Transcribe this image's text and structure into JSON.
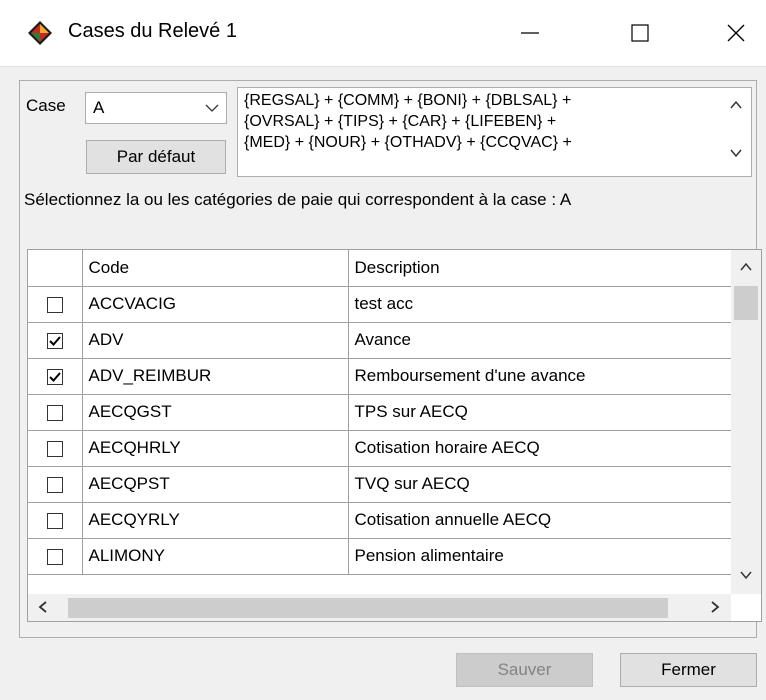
{
  "window": {
    "title": "Cases du Relevé 1",
    "minimize_icon": "minimize-icon",
    "maximize_icon": "maximize-icon",
    "close_icon": "close-icon"
  },
  "case": {
    "label": "Case",
    "selected": "A",
    "default_button": "Par défaut"
  },
  "formula": {
    "lines": [
      "{REGSAL} + {COMM} + {BONI} + {DBLSAL} +",
      "{OVRSAL} + {TIPS} + {CAR} + {LIFEBEN} +",
      "{MED} + {NOUR} + {OTHADV} + {CCQVAC} +"
    ]
  },
  "instruction": "Sélectionnez la ou les catégories de paie qui correspondent à la case : A",
  "grid": {
    "headers": {
      "code": "Code",
      "description": "Description"
    },
    "rows": [
      {
        "checked": false,
        "code": "ACCVACIG",
        "description": "test acc"
      },
      {
        "checked": true,
        "code": "ADV",
        "description": "Avance"
      },
      {
        "checked": true,
        "code": "ADV_REIMBUR",
        "description": "Remboursement d'une avance"
      },
      {
        "checked": false,
        "code": "AECQGST",
        "description": "TPS sur AECQ"
      },
      {
        "checked": false,
        "code": "AECQHRLY",
        "description": "Cotisation horaire AECQ"
      },
      {
        "checked": false,
        "code": "AECQPST",
        "description": "TVQ sur AECQ"
      },
      {
        "checked": false,
        "code": "AECQYRLY",
        "description": "Cotisation annuelle AECQ"
      },
      {
        "checked": false,
        "code": "ALIMONY",
        "description": "Pension alimentaire"
      }
    ]
  },
  "buttons": {
    "save": "Sauver",
    "close": "Fermer"
  },
  "colors": {
    "disabled_button": "#cccccc",
    "button": "#e1e1e1",
    "background": "#f0f0f0"
  }
}
